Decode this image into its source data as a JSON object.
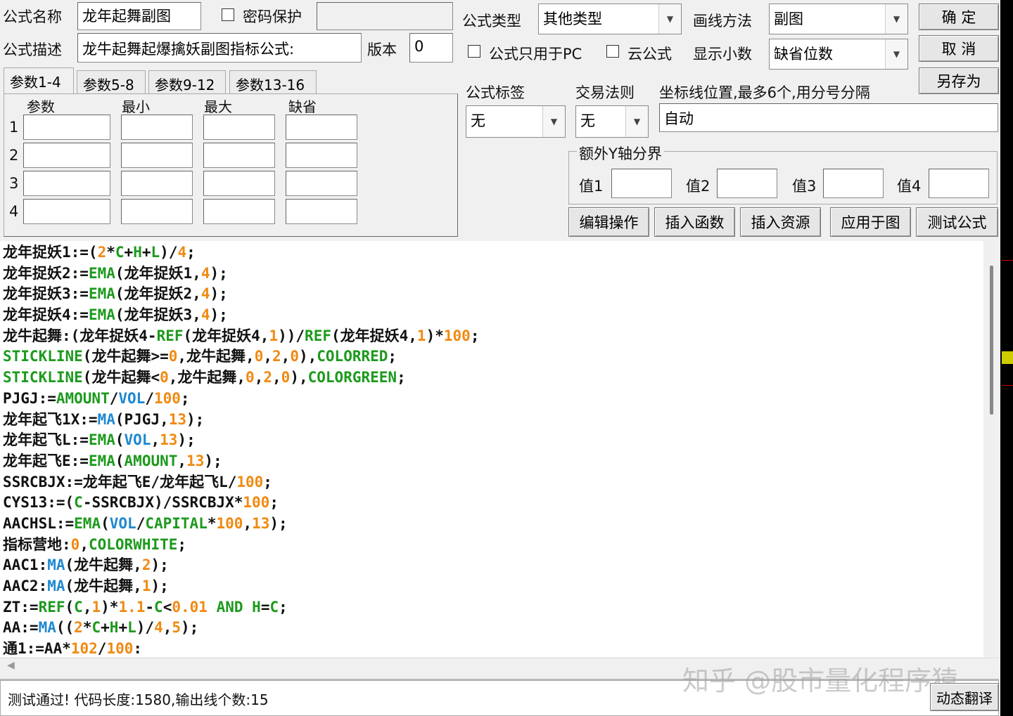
{
  "form": {
    "name_label": "公式名称",
    "name_value": "龙年起舞副图",
    "password_label": "密码保护",
    "password_checked": false,
    "type_label": "公式类型",
    "type_value": "其他类型",
    "draw_label": "画线方法",
    "draw_value": "副图",
    "ok_button": "确  定",
    "desc_label": "公式描述",
    "desc_value": "龙牛起舞起爆擒妖副图指标公式:",
    "version_label": "版本",
    "version_value": "0",
    "pc_only_label": "公式只用于PC",
    "pc_only_checked": false,
    "cloud_label": "云公式",
    "cloud_checked": false,
    "decimal_label": "显示小数",
    "decimal_value": "缺省位数",
    "cancel_button": "取  消",
    "saveas_button": "另存为",
    "tag_label": "公式标签",
    "tag_value": "无",
    "trade_label": "交易法则",
    "trade_value": "无",
    "axis_label": "坐标线位置,最多6个,用分号分隔",
    "axis_value": "自动",
    "yaxis_group": "额外Y轴分界",
    "y_values": [
      {
        "label": "值1",
        "value": ""
      },
      {
        "label": "值2",
        "value": ""
      },
      {
        "label": "值3",
        "value": ""
      },
      {
        "label": "值4",
        "value": ""
      }
    ],
    "buttons": [
      "编辑操作",
      "插入函数",
      "插入资源",
      "应用于图",
      "测试公式"
    ]
  },
  "tabs": [
    "参数1-4",
    "参数5-8",
    "参数9-12",
    "参数13-16"
  ],
  "params": {
    "headers": [
      "参数",
      "最小",
      "最大",
      "缺省"
    ],
    "rows": [
      "1",
      "2",
      "3",
      "4"
    ]
  },
  "code": [
    [
      [
        "龙年捉妖1:=(",
        "p"
      ],
      [
        "2",
        "n"
      ],
      [
        "*",
        "p"
      ],
      [
        "C",
        "f"
      ],
      [
        "+",
        "p"
      ],
      [
        "H",
        "f"
      ],
      [
        "+",
        "p"
      ],
      [
        "L",
        "f"
      ],
      [
        ")/",
        "p"
      ],
      [
        "4",
        "n"
      ],
      [
        ";",
        "p"
      ]
    ],
    [
      [
        "龙年捉妖2:=",
        "p"
      ],
      [
        "EMA",
        "f"
      ],
      [
        "(龙年捉妖1,",
        "p"
      ],
      [
        "4",
        "n"
      ],
      [
        ");",
        "p"
      ]
    ],
    [
      [
        "龙年捉妖3:=",
        "p"
      ],
      [
        "EMA",
        "f"
      ],
      [
        "(龙年捉妖2,",
        "p"
      ],
      [
        "4",
        "n"
      ],
      [
        ");",
        "p"
      ]
    ],
    [
      [
        "龙年捉妖4:=",
        "p"
      ],
      [
        "EMA",
        "f"
      ],
      [
        "(龙年捉妖3,",
        "p"
      ],
      [
        "4",
        "n"
      ],
      [
        ");",
        "p"
      ]
    ],
    [
      [
        "龙牛起舞:(龙年捉妖4-",
        "p"
      ],
      [
        "REF",
        "f"
      ],
      [
        "(龙年捉妖4,",
        "p"
      ],
      [
        "1",
        "n"
      ],
      [
        "))/",
        "p"
      ],
      [
        "REF",
        "f"
      ],
      [
        "(龙年捉妖4,",
        "p"
      ],
      [
        "1",
        "n"
      ],
      [
        ")*",
        "p"
      ],
      [
        "100",
        "n"
      ],
      [
        ";",
        "p"
      ]
    ],
    [
      [
        "STICKLINE",
        "f"
      ],
      [
        "(龙牛起舞>=",
        "p"
      ],
      [
        "0",
        "n"
      ],
      [
        ",龙牛起舞,",
        "p"
      ],
      [
        "0",
        "n"
      ],
      [
        ",",
        "p"
      ],
      [
        "2",
        "n"
      ],
      [
        ",",
        "p"
      ],
      [
        "0",
        "n"
      ],
      [
        "),",
        "p"
      ],
      [
        "COLORRED",
        "f"
      ],
      [
        ";",
        "p"
      ]
    ],
    [
      [
        "STICKLINE",
        "f"
      ],
      [
        "(龙牛起舞<",
        "p"
      ],
      [
        "0",
        "n"
      ],
      [
        ",龙牛起舞,",
        "p"
      ],
      [
        "0",
        "n"
      ],
      [
        ",",
        "p"
      ],
      [
        "2",
        "n"
      ],
      [
        ",",
        "p"
      ],
      [
        "0",
        "n"
      ],
      [
        "),",
        "p"
      ],
      [
        "COLORGREEN",
        "f"
      ],
      [
        ";",
        "p"
      ]
    ],
    [
      [
        "PJGJ:=",
        "p"
      ],
      [
        "AMOUNT",
        "f"
      ],
      [
        "/",
        "p"
      ],
      [
        "VOL",
        "b"
      ],
      [
        "/",
        "p"
      ],
      [
        "100",
        "n"
      ],
      [
        ";",
        "p"
      ]
    ],
    [
      [
        "龙年起飞1X:=",
        "p"
      ],
      [
        "MA",
        "b"
      ],
      [
        "(PJGJ,",
        "p"
      ],
      [
        "13",
        "n"
      ],
      [
        ");",
        "p"
      ]
    ],
    [
      [
        "龙年起飞L:=",
        "p"
      ],
      [
        "EMA",
        "f"
      ],
      [
        "(",
        "p"
      ],
      [
        "VOL",
        "b"
      ],
      [
        ",",
        "p"
      ],
      [
        "13",
        "n"
      ],
      [
        ");",
        "p"
      ]
    ],
    [
      [
        "龙年起飞E:=",
        "p"
      ],
      [
        "EMA",
        "f"
      ],
      [
        "(",
        "p"
      ],
      [
        "AMOUNT",
        "f"
      ],
      [
        ",",
        "p"
      ],
      [
        "13",
        "n"
      ],
      [
        ");",
        "p"
      ]
    ],
    [
      [
        "SSRCBJX:=龙年起飞E/龙年起飞L/",
        "p"
      ],
      [
        "100",
        "n"
      ],
      [
        ";",
        "p"
      ]
    ],
    [
      [
        "CYS13:=(",
        "p"
      ],
      [
        "C",
        "f"
      ],
      [
        "-SSRCBJX)/SSRCBJX*",
        "p"
      ],
      [
        "100",
        "n"
      ],
      [
        ";",
        "p"
      ]
    ],
    [
      [
        "AACHSL:=",
        "p"
      ],
      [
        "EMA",
        "f"
      ],
      [
        "(",
        "p"
      ],
      [
        "VOL",
        "b"
      ],
      [
        "/",
        "p"
      ],
      [
        "CAPITAL",
        "f"
      ],
      [
        "*",
        "p"
      ],
      [
        "100",
        "n"
      ],
      [
        ",",
        "p"
      ],
      [
        "13",
        "n"
      ],
      [
        ");",
        "p"
      ]
    ],
    [
      [
        "指标营地:",
        "p"
      ],
      [
        "0",
        "n"
      ],
      [
        ",",
        "p"
      ],
      [
        "COLORWHITE",
        "f"
      ],
      [
        ";",
        "p"
      ]
    ],
    [
      [
        "AAC1:",
        "p"
      ],
      [
        "MA",
        "b"
      ],
      [
        "(龙牛起舞,",
        "p"
      ],
      [
        "2",
        "n"
      ],
      [
        ");",
        "p"
      ]
    ],
    [
      [
        "AAC2:",
        "p"
      ],
      [
        "MA",
        "b"
      ],
      [
        "(龙牛起舞,",
        "p"
      ],
      [
        "1",
        "n"
      ],
      [
        ");",
        "p"
      ]
    ],
    [
      [
        "ZT:=",
        "p"
      ],
      [
        "REF",
        "f"
      ],
      [
        "(",
        "p"
      ],
      [
        "C",
        "f"
      ],
      [
        ",",
        "p"
      ],
      [
        "1",
        "n"
      ],
      [
        ")*",
        "p"
      ],
      [
        "1.1",
        "n"
      ],
      [
        "-",
        "p"
      ],
      [
        "C",
        "f"
      ],
      [
        "<",
        "p"
      ],
      [
        "0.01",
        "n"
      ],
      [
        " ",
        "p"
      ],
      [
        "AND",
        "f"
      ],
      [
        " ",
        "p"
      ],
      [
        "H",
        "f"
      ],
      [
        "=",
        "p"
      ],
      [
        "C",
        "f"
      ],
      [
        ";",
        "p"
      ]
    ],
    [
      [
        "AA:=",
        "p"
      ],
      [
        "MA",
        "b"
      ],
      [
        "((",
        "p"
      ],
      [
        "2",
        "n"
      ],
      [
        "*",
        "p"
      ],
      [
        "C",
        "f"
      ],
      [
        "+",
        "p"
      ],
      [
        "H",
        "f"
      ],
      [
        "+",
        "p"
      ],
      [
        "L",
        "f"
      ],
      [
        ")/",
        "p"
      ],
      [
        "4",
        "n"
      ],
      [
        ",",
        "p"
      ],
      [
        "5",
        "n"
      ],
      [
        ");",
        "p"
      ]
    ],
    [
      [
        "通1:=AA*",
        "p"
      ],
      [
        "102",
        "n"
      ],
      [
        "/",
        "p"
      ],
      [
        "100",
        "n"
      ],
      [
        ":",
        "p"
      ]
    ]
  ],
  "status": {
    "text": "测试通过! 代码长度:1580,输出线个数:15",
    "translate_button": "动态翻译"
  },
  "watermark": "知乎 @股市量化程序猿",
  "colors": {
    "function": "#1d9a1d",
    "number": "#f08a12",
    "builtin_blue": "#1e88d0"
  }
}
